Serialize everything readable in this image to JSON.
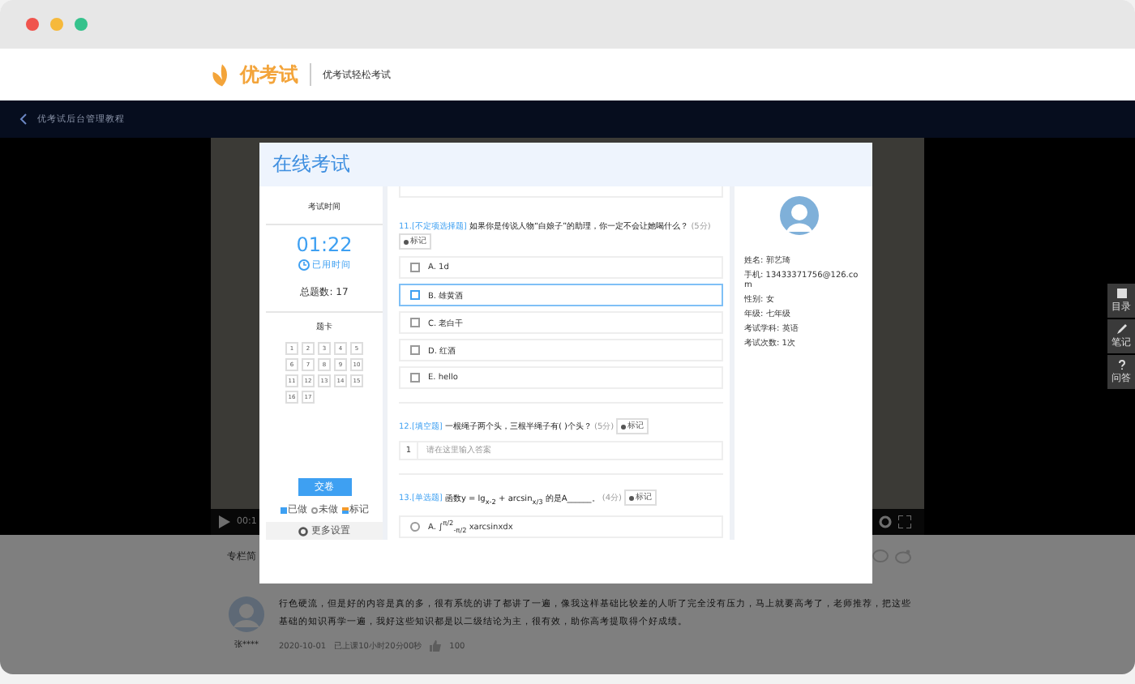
{
  "header": {
    "logo": "优考试",
    "slogan": "优考试轻松考试"
  },
  "nav": {
    "title": "优考试后台管理教程"
  },
  "video": {
    "time": "00:1"
  },
  "side_tools": [
    {
      "kind": "list",
      "label": "目录"
    },
    {
      "kind": "pen",
      "label": "笔记"
    },
    {
      "kind": "question",
      "label": "问答"
    }
  ],
  "section": {
    "title": "专栏简"
  },
  "comment": {
    "user": "张****",
    "text": "行色硬流，但是好的内容是真的多，很有系统的讲了都讲了一遍，像我这样基础比较差的人听了完全没有压力，马上就要高考了，老师推荐，把这些基础的知识再学一遍，我好这些知识都是以二级结论为主，很有效，助你高考提取得个好成绩。",
    "date": "2020-10-01",
    "progress": "已上课10小时20分00秒",
    "likes": "100"
  },
  "exam": {
    "title": "在线考试",
    "info_label": "考试时间",
    "timer": "01:22",
    "timer_label": "已用时间",
    "total": "总题数: 17",
    "card_title": "题卡",
    "numbers": [
      "1",
      "2",
      "3",
      "4",
      "5",
      "6",
      "7",
      "8",
      "9",
      "10",
      "11",
      "12",
      "13",
      "14",
      "15",
      "16",
      "17"
    ],
    "submit": "交卷",
    "legend": [
      {
        "kind": "done",
        "label": "已做"
      },
      {
        "kind": "todo",
        "label": "未做"
      },
      {
        "kind": "marked",
        "label": "标记"
      }
    ],
    "settings": "更多设置",
    "questions": [
      {
        "kind": "checkbox",
        "number": "11.",
        "type": "[不定项选择题]",
        "text": "如果你是传说人物“白娘子”的助理，你一定不会让她喝什么？",
        "score": "(5分)",
        "mark": "标记",
        "options": [
          {
            "label": "A. 1d",
            "selected": false
          },
          {
            "label": "B. 雄黄酒",
            "selected": true
          },
          {
            "label": "C. 老白干",
            "selected": false
          },
          {
            "label": "D. 红酒",
            "selected": false
          },
          {
            "label": "E. hello",
            "selected": false
          }
        ]
      },
      {
        "kind": "fill",
        "number": "12.",
        "type": "[填空题]",
        "text": "一根绳子两个头，三根半绳子有(      )个头？",
        "score": "(5分)",
        "mark": "标记",
        "blank_index": "1",
        "placeholder": "请在这里输入答案"
      },
      {
        "kind": "radio",
        "number": "13.",
        "type": "[单选题]",
        "text": "函数y = lg$_{x-2}$ + arcsin$_{x/3}$ 的是A______。",
        "score": "(4分)",
        "mark": "标记",
        "options": [
          {
            "label": "A. ∫$^{π/2}$$_{-π/2}$ xarcsinxdx",
            "selected": false
          }
        ]
      }
    ],
    "student": [
      "姓名: 郭艺琦",
      "手机: 13433371756@126.com",
      "性别: 女",
      "年级: 七年级",
      "考试学科: 英语",
      "考试次数: 1次"
    ]
  }
}
